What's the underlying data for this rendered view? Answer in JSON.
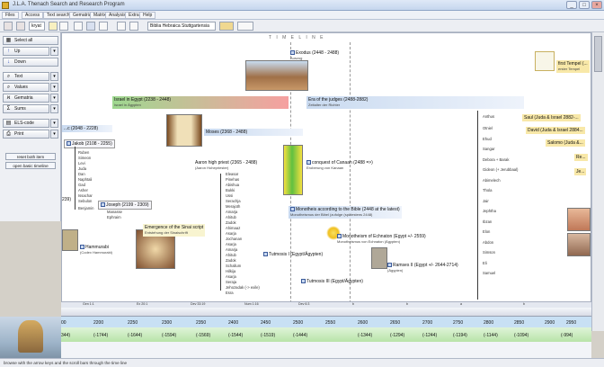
{
  "window": {
    "title": "J.L.A. Thenach Search and Research Program",
    "controls": [
      "_",
      "□",
      "×"
    ]
  },
  "menu": [
    "Files",
    "Access",
    "Text search",
    "Gematria",
    "Matrix",
    "Analysis",
    "Extra",
    "Help"
  ],
  "toolbar": {
    "word_field": "kryat",
    "bible_field": "Biblia Hebraica Stuttgartensia"
  },
  "sidebar": {
    "buttons": [
      {
        "label": "Select all",
        "icon": "select-all-icon"
      },
      {
        "label": "Up",
        "icon": "arrow-up-icon"
      },
      {
        "label": "Down",
        "icon": "arrow-down-icon"
      },
      {
        "label": "Text",
        "icon": "search-icon"
      },
      {
        "label": "Values",
        "icon": "values-icon"
      },
      {
        "label": "Gematria",
        "icon": "gematria-icon"
      },
      {
        "label": "Sums",
        "icon": "sum-icon"
      },
      {
        "label": "ELS-code",
        "icon": "els-icon"
      },
      {
        "label": "Print",
        "icon": "print-icon"
      }
    ],
    "reset_button": "reset both item",
    "open_timeline": "open basic timeline"
  },
  "timeline": {
    "label": "T I M E L I N E",
    "exodus": {
      "title": "Exodus (2448 - 2488)",
      "sub": "Auszug"
    },
    "first_temple": {
      "title": "first Tempel (...",
      "sub": "erster Tempel"
    },
    "israel_egypt": {
      "title": "Israel in Egypt (2238 - 2448)",
      "sub": "Israel in Ägypten"
    },
    "judges": {
      "title": "Era of the judges (2488-2882)",
      "sub": "Zeitalter der Richter"
    },
    "left_era": "...c (2048 - 2228)",
    "moses": "Moses (2368 - 2488)",
    "jakob": "Jakob (2108 - 2255)",
    "jakob_sons": [
      "Ruben",
      "Simeon",
      "Levi",
      "Juda",
      "Dan",
      "Naphtali",
      "Gad",
      "Asher",
      "Issachar",
      "Sebulon"
    ],
    "benjamin": "Benjamin",
    "joseph": "Joseph (2199 - 2309)",
    "joseph_sons": [
      "Manasse",
      "Ephraim"
    ],
    "left_cut": "239)",
    "aaron": {
      "title": "Aaron high priest (2365 - 2488)",
      "sub": "(Aaron Hohepriester)"
    },
    "priests": [
      "Eleasar",
      "Pinehas",
      "Abishua",
      "Bukki",
      "Ussi",
      "Serachja",
      "Merajoth",
      "Amarja",
      "Ahitub",
      "Zadok",
      "Ahimaaz",
      "Asarja",
      "Jochanan",
      "Asarja",
      "Amarja",
      "Ahitub",
      "Zadok",
      "Schallum",
      "Hilkija",
      "Asarja",
      "Seraja",
      "Jehozadak (-> exile)",
      "Esra"
    ],
    "canaan": {
      "title": "conquest of Canaan (2488 =>)",
      "sub": "Eroberung von Kanaan"
    },
    "monotheism": {
      "title": "Monotheis according to the Bible (2448 at the latest)",
      "sub": "Monotheismus der Bibel (zufolge (spätestens 2448)"
    },
    "sinai": {
      "title": "Emergence of the Sinai script",
      "sub": "Entstehung der Sinaischrift"
    },
    "hammurabi": {
      "title": "Hammurabi",
      "sub": "(Codex Hammurabi)"
    },
    "monotheism_echnaton": {
      "title": "Monotheism of Echnaton (Egypt +/- 2559)",
      "sub": "Monotheismus von Echnaton (Ägypten)"
    },
    "ramses": {
      "title": "Ramses II (Egypt +/- 2644-2714)",
      "sub": "(Ägypten)"
    },
    "tutmosis1": "Tutmosis I (Egypt/Ägypten)",
    "tutmosis3": "Tutmosis III (Egypt/Ägypten)",
    "judges_list": [
      "Otniel",
      "Ehud",
      "Sangar",
      "Debora + Barak",
      "Gideon (+ Jerubbaal)",
      "Abimelech",
      "Thola",
      "Jair",
      "Jephtha",
      "Ibzan",
      "Elon",
      "Abdon",
      "Simson",
      "Eli",
      "Samuel"
    ],
    "anthus": "Anthus",
    "kings": [
      "Saul (Juda & Israel 2882-...",
      "David (Juda & Israel 2884...",
      "Salomo (Juda &...",
      "Re...",
      "Je..."
    ]
  },
  "ruler": {
    "segment_labels": [
      "Gen 1:1",
      "Ex 20:1",
      "Dev 33:19",
      "Num 1:16",
      "Dev 6:3",
      "b",
      "b",
      "a",
      "b"
    ],
    "years": [
      "00",
      "2200",
      "2250",
      "2300",
      "2350",
      "2400",
      "2450",
      "2500",
      "2550",
      "2600",
      "2650",
      "2700",
      "2750",
      "2800",
      "2850",
      "2900",
      "2950"
    ],
    "years_bce": [
      "344)",
      "(-1744)",
      "(-1644)",
      "(-1594)",
      "(-1569)",
      "(-1544)",
      "(-1519)",
      "(-1444)",
      "(-1344)",
      "(-1294)",
      "(-1244)",
      "(-1194)",
      "(-1144)",
      "(-1094)",
      "(-994)"
    ]
  },
  "status": "browse with the arrow keys and the scroll bars through the time line"
}
